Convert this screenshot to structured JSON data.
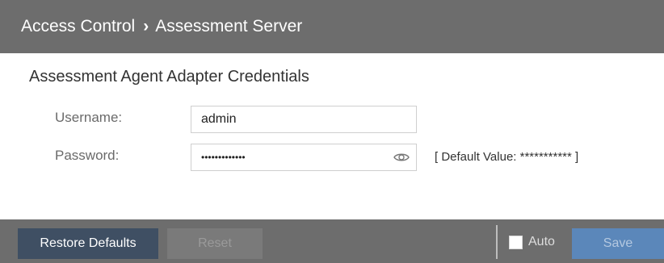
{
  "header": {
    "breadcrumb_parent": "Access Control",
    "breadcrumb_separator": "›",
    "breadcrumb_current": "Assessment Server"
  },
  "section": {
    "title": "Assessment Agent Adapter Credentials"
  },
  "form": {
    "username_label": "Username:",
    "username_value": "admin",
    "password_label": "Password:",
    "password_value": "•••••••••••••",
    "password_icon": "eye-icon",
    "default_value_text": "[ Default Value: *********** ]"
  },
  "footer": {
    "restore_label": "Restore Defaults",
    "reset_label": "Reset",
    "auto_label": "Auto",
    "auto_checked": false,
    "save_label": "Save"
  },
  "colors": {
    "header_bg": "#6d6d6d",
    "restore_bg": "#3f4f63",
    "save_bg": "#5b87ba"
  }
}
